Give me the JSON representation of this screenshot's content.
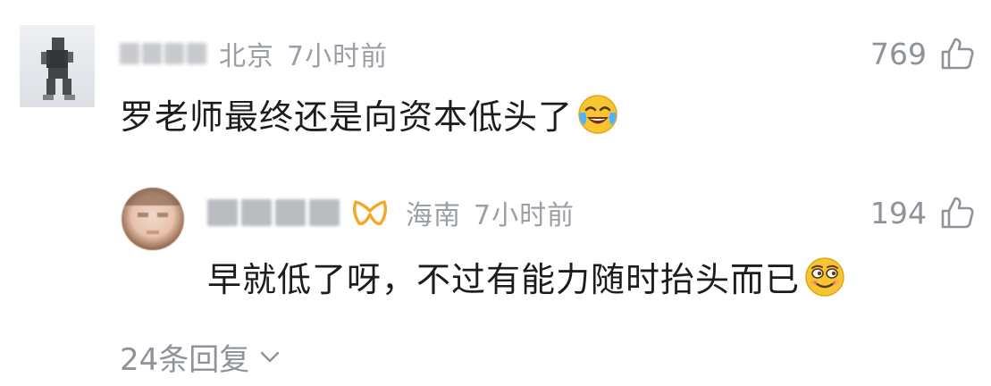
{
  "comment": {
    "location": "北京",
    "time": "7小时前",
    "likes": "769",
    "text": "罗老师最终还是向资本低头了",
    "emoji": "crying-laughing"
  },
  "reply": {
    "location": "海南",
    "time": "7小时前",
    "likes": "194",
    "text": "早就低了呀，不过有能力随时抬头而已",
    "emoji": "smirk-grin"
  },
  "more_replies": "24条回复",
  "colors": {
    "meta": "#9a9ea5",
    "text": "#1c1c1e",
    "vip": "#f5a623",
    "emoji_face": "#f7c531"
  }
}
